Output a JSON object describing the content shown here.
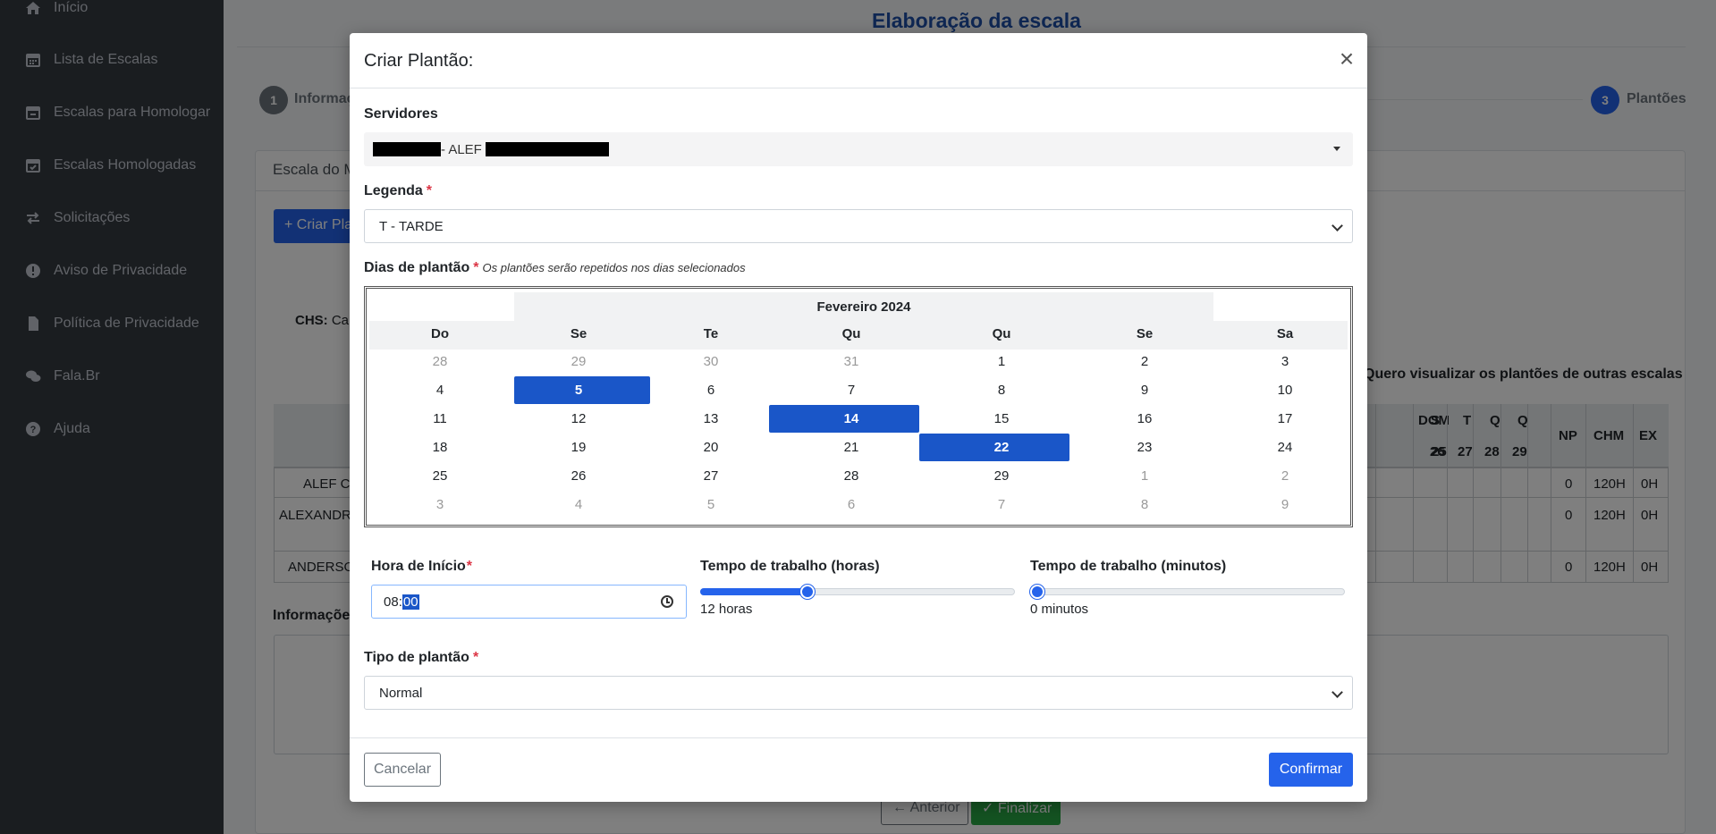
{
  "sidebar": {
    "items": [
      {
        "label": "Início",
        "icon": "home-icon"
      },
      {
        "label": "Lista de Escalas",
        "icon": "calendar-icon"
      },
      {
        "label": "Escalas para Homologar",
        "icon": "calendar-pending-icon"
      },
      {
        "label": "Escalas Homologadas",
        "icon": "calendar-check-icon"
      },
      {
        "label": "Solicitações",
        "icon": "exchange-icon"
      },
      {
        "label": "Aviso de Privacidade",
        "icon": "info-icon"
      },
      {
        "label": "Política de Privacidade",
        "icon": "document-icon"
      },
      {
        "label": "Fala.Br",
        "icon": "chat-icon"
      },
      {
        "label": "Ajuda",
        "icon": "help-icon"
      }
    ]
  },
  "page": {
    "title": "Elaboração da escala",
    "steps": [
      {
        "number": "1",
        "label": "Informaç"
      },
      {
        "number": "3",
        "label": "Plantões"
      }
    ],
    "card_title": "Escala do M",
    "create_button": "+ Criar Pla",
    "chs_label": "CHS:",
    "chs_value": "Car",
    "other_scales_link": "Quero visualizar os plantões de outras escalas",
    "table": {
      "day_headers": [
        "DOM",
        "S",
        "T",
        "Q",
        "Q"
      ],
      "date_headers": [
        "25",
        "26",
        "27",
        "28",
        "29"
      ],
      "summary_headers": [
        "NP",
        "CHM",
        "EX"
      ],
      "rows": [
        {
          "name": "ALEF CA",
          "np": "0",
          "chm": "120H",
          "ex": "0H"
        },
        {
          "name": "ALEXANDRE",
          "np": "0",
          "chm": "120H",
          "ex": "0H"
        },
        {
          "name": "ANDERSO",
          "np": "0",
          "chm": "120H",
          "ex": "0H"
        }
      ]
    },
    "info_label": "Informações",
    "prev_button": "Anterior",
    "finish_button": "Finalizar"
  },
  "modal": {
    "title": "Criar Plantão:",
    "servers_label": "Servidores",
    "server_value": "- ALEF",
    "legend_label": "Legenda",
    "legend_value": "T - TARDE",
    "days_label": "Dias de plantão",
    "days_hint": "Os plantões serão repetidos nos dias selecionados",
    "calendar": {
      "month": "Fevereiro 2024",
      "weekdays": [
        "Do",
        "Se",
        "Te",
        "Qu",
        "Qu",
        "Se",
        "Sa"
      ],
      "weeks": [
        [
          "28",
          "29",
          "30",
          "31",
          "1",
          "2",
          "3"
        ],
        [
          "4",
          "5",
          "6",
          "7",
          "8",
          "9",
          "10"
        ],
        [
          "11",
          "12",
          "13",
          "14",
          "15",
          "16",
          "17"
        ],
        [
          "18",
          "19",
          "20",
          "21",
          "22",
          "23",
          "24"
        ],
        [
          "25",
          "26",
          "27",
          "28",
          "29",
          "1",
          "2"
        ],
        [
          "3",
          "4",
          "5",
          "6",
          "7",
          "8",
          "9"
        ]
      ],
      "selected_days": [
        "5",
        "14",
        "22"
      ]
    },
    "start_time_label": "Hora de Início",
    "start_time_hour": "08",
    "start_time_min": "00",
    "hours_label": "Tempo de trabalho (horas)",
    "hours_value_text": "12 horas",
    "hours_fraction": 0.34,
    "minutes_label": "Tempo de trabalho (minutos)",
    "minutes_value_text": "0 minutos",
    "minutes_fraction": 0.0,
    "type_label": "Tipo de plantão",
    "type_value": "Normal",
    "cancel_button": "Cancelar",
    "confirm_button": "Confirmar",
    "close_symbol": "×"
  },
  "colors": {
    "sidebar_bg": "#343a40",
    "primary": "#2563eb",
    "selected_day": "#1a56c8",
    "title_blue": "#1e4fa6",
    "success": "#28a745",
    "required": "#dc3545"
  }
}
